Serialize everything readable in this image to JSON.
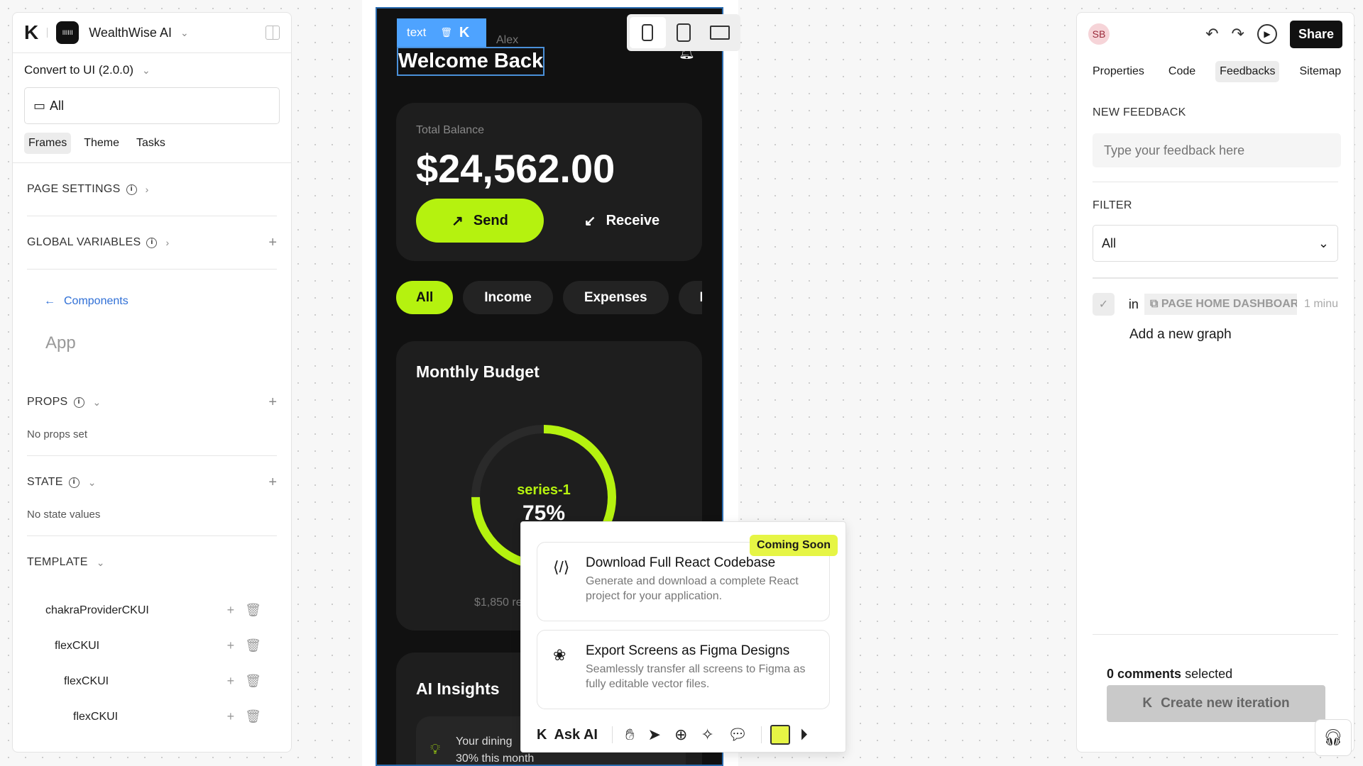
{
  "left": {
    "project": "WealthWise AI",
    "version": "Convert to UI (2.0.0)",
    "device_filter": "All",
    "tabs": [
      "Frames",
      "Theme",
      "Tasks"
    ],
    "active_tab": "Frames",
    "page_settings": "PAGE SETTINGS",
    "global_variables": "GLOBAL VARIABLES",
    "back_link": "Components",
    "component": "App",
    "props": "PROPS",
    "no_props": "No props set",
    "state": "STATE",
    "no_state": "No state values",
    "template": "TEMPLATE",
    "tree": [
      "chakraProviderCKUI",
      "flexCKUI",
      "flexCKUI",
      "flexCKUI"
    ]
  },
  "canvas": {
    "selection_label": "text",
    "greeting": "Alex",
    "title": "Welcome Back",
    "balance_label": "Total Balance",
    "balance": "$24,562.00",
    "send": "Send",
    "receive": "Receive",
    "chips": [
      "All",
      "Income",
      "Expenses",
      "Inv"
    ],
    "active_chip": "All",
    "budget_title": "Monthly Budget",
    "series": "series-1",
    "percent_text": "75%",
    "percent": 75,
    "remaining": "$1,850 re",
    "insights_title": "AI Insights",
    "insight_line1": "Your dining",
    "insight_line2": "30% this month",
    "accent": "#b5f20f"
  },
  "popup": {
    "badge": "Coming Soon",
    "options": [
      {
        "title": "Download Full React Codebase",
        "desc": "Generate and download a complete React project for your application."
      },
      {
        "title": "Export Screens as Figma Designs",
        "desc": "Seamlessly transfer all screens to Figma as fully editable vector files."
      }
    ],
    "ask_ai": "Ask AI"
  },
  "right": {
    "avatar": "SB",
    "share": "Share",
    "tabs": [
      "Properties",
      "Code",
      "Feedbacks",
      "Sitemap"
    ],
    "active_tab": "Feedbacks",
    "new_feedback": "NEW FEEDBACK",
    "feedback_placeholder": "Type your feedback here",
    "filter": "FILTER",
    "filter_value": "All",
    "item": {
      "in": "in",
      "page": "PAGE HOME DASHBOARD",
      "time": "1 minu",
      "text": "Add a new graph"
    },
    "comments_count": "0 comments",
    "comments_suffix": "selected",
    "create": "Create new iteration"
  }
}
